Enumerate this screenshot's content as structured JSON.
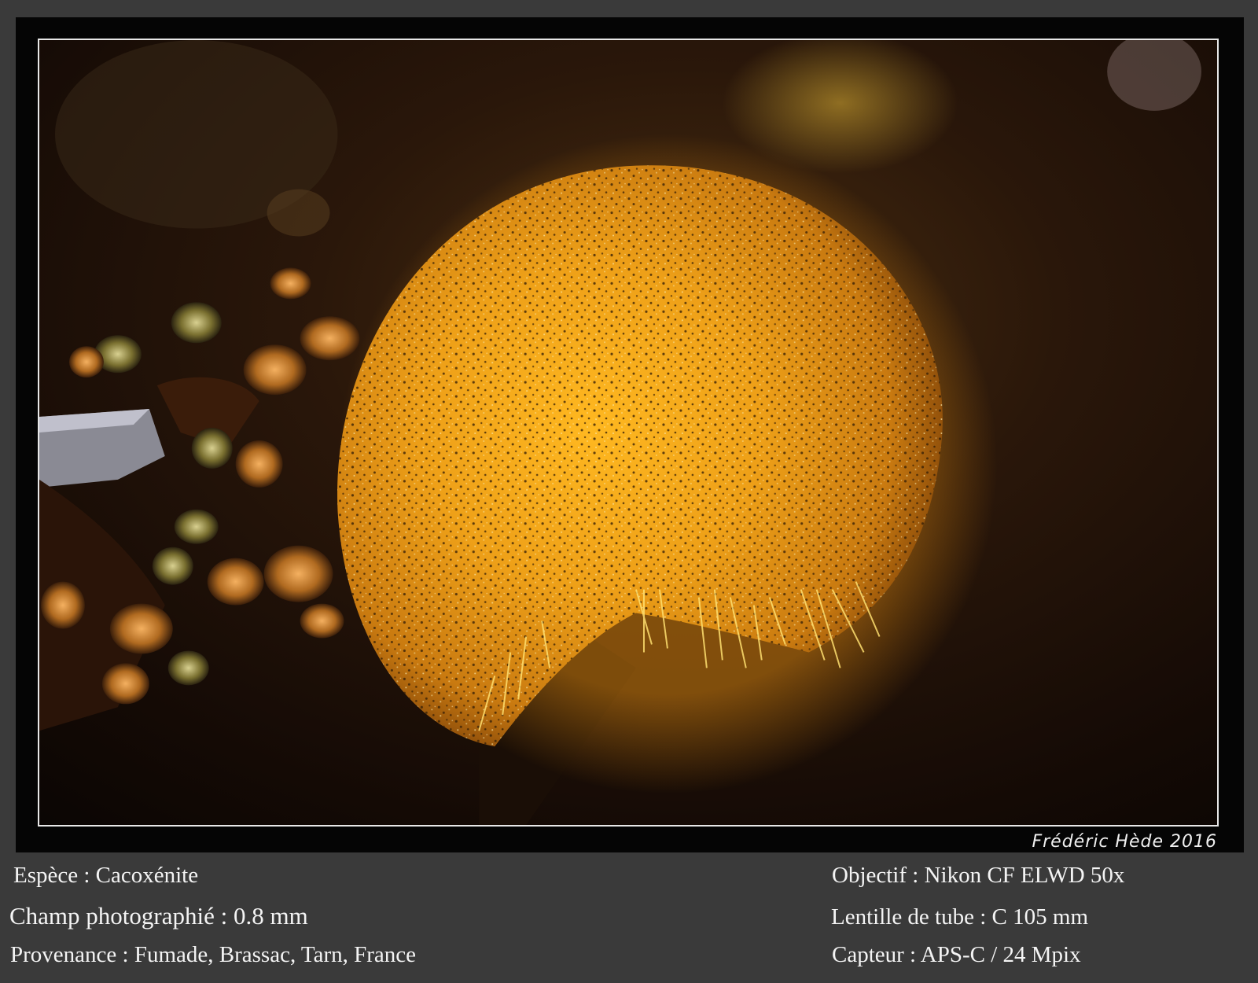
{
  "photo": {
    "signature": "Frédéric Hède 2016",
    "subject": "photograph"
  },
  "captions": {
    "species": "Espèce : Cacoxénite",
    "field": "Champ photographié : 0.8 mm",
    "origin": "Provenance : Fumade, Brassac, Tarn, France",
    "objective": "Objectif : Nikon CF ELWD 50x",
    "tube_lens": "Lentille de tube : C 105 mm",
    "sensor": "Capteur : APS-C / 24 Mpix"
  },
  "colors": {
    "background": "#3a3a3a",
    "frame": "#050505",
    "border": "#e8e8e8",
    "sphere": "#e8a020",
    "text": "#f4f4f4"
  }
}
